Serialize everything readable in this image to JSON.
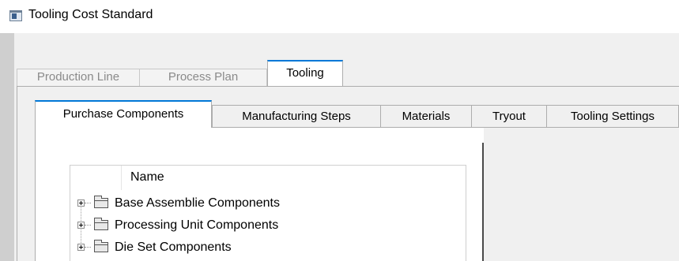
{
  "window": {
    "title": "Tooling Cost Standard",
    "icon": "app-window-icon"
  },
  "outer_tabs": [
    {
      "label": "Production Line",
      "active": false
    },
    {
      "label": "Process Plan",
      "active": false
    },
    {
      "label": "Tooling",
      "active": true
    }
  ],
  "inner_tabs": [
    {
      "label": "Purchase Components",
      "active": true
    },
    {
      "label": "Manufacturing Steps",
      "active": false
    },
    {
      "label": "Materials",
      "active": false
    },
    {
      "label": "Tryout",
      "active": false
    },
    {
      "label": "Tooling Settings",
      "active": false
    }
  ],
  "tree": {
    "column_header": "Name",
    "items": [
      {
        "label": "Base Assemblie Components",
        "icon": "folder-icon",
        "expander": "plus"
      },
      {
        "label": "Processing Unit Components",
        "icon": "folder-icon",
        "expander": "plus"
      },
      {
        "label": "Die Set Components",
        "icon": "folder-icon",
        "expander": "plus"
      }
    ]
  },
  "colors": {
    "active_tab_accent": "#0078d7",
    "client_background": "#f0f0f0",
    "inactive_tab_text": "#8a8a8a"
  }
}
